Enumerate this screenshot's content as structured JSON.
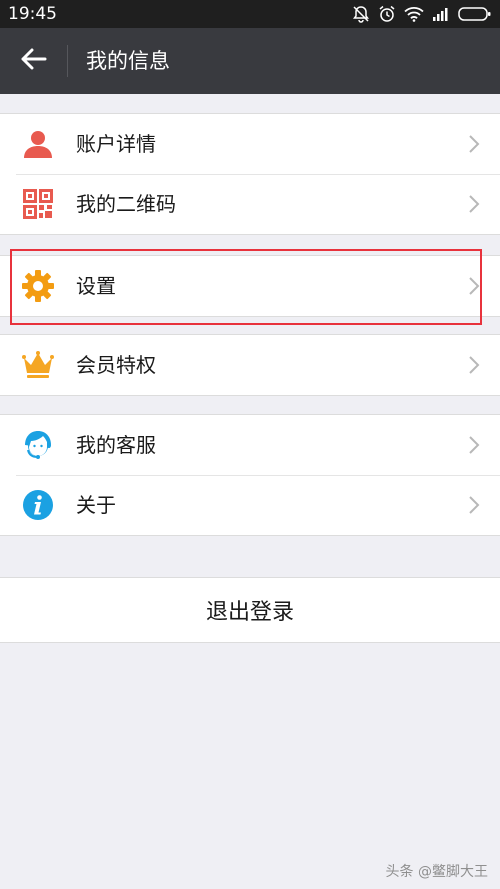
{
  "status_bar": {
    "time": "19:45",
    "icons": [
      "mute-icon",
      "alarm-icon",
      "wifi-icon",
      "signal-icon",
      "battery-icon"
    ]
  },
  "header": {
    "title": "我的信息"
  },
  "groups": [
    {
      "items": [
        {
          "label": "账户详情",
          "icon": "user-icon",
          "icon_color": "#e85a4f"
        },
        {
          "label": "我的二维码",
          "icon": "qr-code-icon",
          "icon_color": "#e85a4f"
        }
      ]
    },
    {
      "items": [
        {
          "label": "设置",
          "icon": "gear-icon",
          "icon_color": "#f39c12"
        }
      ]
    },
    {
      "items": [
        {
          "label": "会员特权",
          "icon": "crown-icon",
          "icon_color": "#f5a623"
        }
      ]
    },
    {
      "items": [
        {
          "label": "我的客服",
          "icon": "customer-service-icon",
          "icon_color": "#1ba1e2"
        },
        {
          "label": "关于",
          "icon": "info-icon",
          "icon_color": "#1ba1e2"
        }
      ]
    }
  ],
  "logout": {
    "label": "退出登录"
  },
  "annotation": {
    "highlight_color": "#e8323c"
  },
  "watermark": "头条 @鳖脚大王"
}
